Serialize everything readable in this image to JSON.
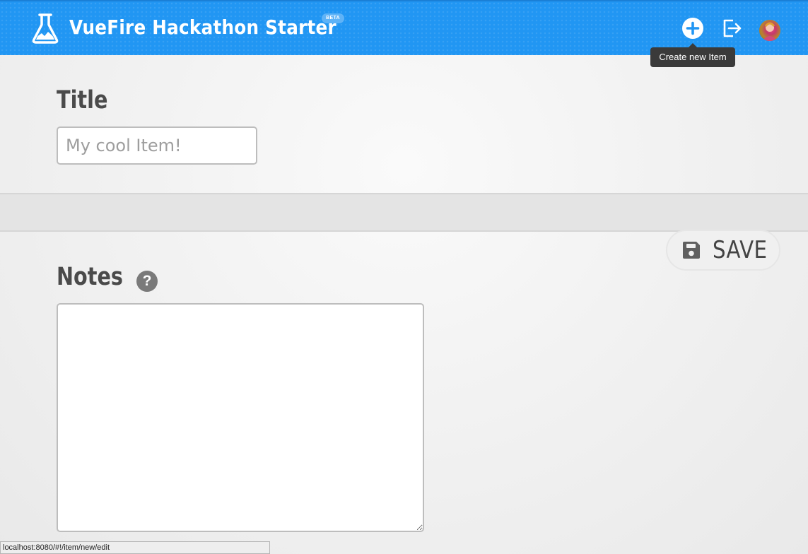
{
  "header": {
    "app_title": "VueFire Hackathon Starter",
    "beta_badge": "BETA",
    "add_item_icon": "plus-circle-icon",
    "logout_icon": "logout-icon",
    "tooltip": "Create new Item",
    "color": "#2196f3"
  },
  "form": {
    "title_label": "Title",
    "title_placeholder": "My cool Item!",
    "title_value": "",
    "notes_label": "Notes",
    "notes_help_icon": "?",
    "notes_value": ""
  },
  "actions": {
    "save_label": "SAVE",
    "save_icon": "floppy-disk-icon"
  },
  "status_bar": {
    "url": "localhost:8080/#!/item/new/edit"
  }
}
